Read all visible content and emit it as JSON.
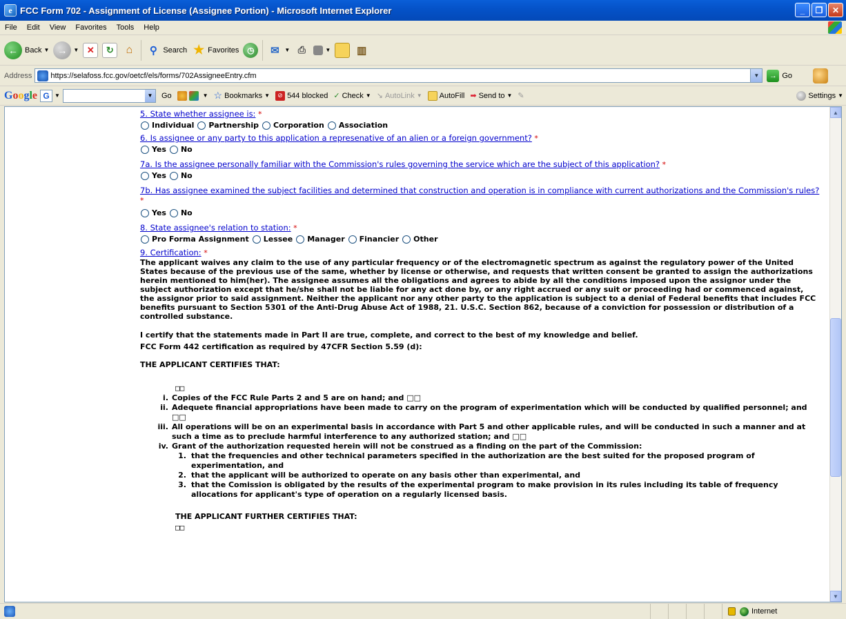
{
  "window": {
    "title": "FCC Form 702 - Assignment of License (Assignee Portion) - Microsoft Internet Explorer"
  },
  "menu": [
    "File",
    "Edit",
    "View",
    "Favorites",
    "Tools",
    "Help"
  ],
  "toolbar": {
    "back_label": "Back",
    "search_label": "Search",
    "favorites_label": "Favorites"
  },
  "address": {
    "label": "Address",
    "url": "https://selafoss.fcc.gov/oetcf/els/forms/702AssigneeEntry.cfm",
    "go_label": "Go"
  },
  "googlebar": {
    "go_label": "Go",
    "bookmarks_label": "Bookmarks",
    "blocked_label": "544 blocked",
    "check_label": "Check",
    "autolink_label": "AutoLink",
    "autofill_label": "AutoFill",
    "sendto_label": "Send to",
    "settings_label": "Settings"
  },
  "form": {
    "q5": {
      "label": "5. State whether assignee is:",
      "star": "*",
      "options": [
        "Individual",
        "Partnership",
        "Corporation",
        "Association"
      ]
    },
    "q6": {
      "label": "6. Is assignee or any party to this application a represenative of an alien or a foreign government?",
      "star": "*",
      "options": [
        "Yes",
        "No"
      ]
    },
    "q7a": {
      "label": "7a. Is the assignee personally familiar with the Commission's rules governing the service which are the subject of this application?",
      "star": "*",
      "options": [
        "Yes",
        "No"
      ]
    },
    "q7b": {
      "label": "7b. Has assignee examined the subject facilities and determined that construction and operation is in compliance with current authorizations and the Commission's rules?",
      "star": "*",
      "options": [
        "Yes",
        "No"
      ]
    },
    "q8": {
      "label": "8. State assignee's relation to station:",
      "star": "*",
      "options": [
        "Pro Forma Assignment",
        "Lessee",
        "Manager",
        "Financier",
        "Other"
      ]
    },
    "q9": {
      "label": "9. Certification:",
      "star": "*",
      "text": "The applicant waives any claim to the use of any particular frequency or of the electromagnetic spectrum as against the regulatory power of the United States because of the previous use of the same, whether by license or otherwise, and requests that written consent be granted to assign the authorizations herein mentioned to him(her). The assignee assumes all the obligations and agrees to abide by all the conditions imposed upon the assignor under the subject authorization except that he/she shall not be liable for any act done by, or any right accrued or any suit or proceeding had or commenced against, the assignor prior to said assignment. Neither the applicant nor any other party to the application is subject to a denial of Federal benefits that includes FCC benefits pursuant to Section 5301 of the Anti-Drug Abuse Act of 1988, 21. U.S.C. Section 862, because of a conviction for possession or distribution of a controlled substance.",
      "certify": "I certify that the statements made in Part II are true, complete, and correct to the best of my knowledge and belief.",
      "form442": "FCC Form 442 certification as required by 47CFR Section 5.59 (d):",
      "applicant_certifies": "THE APPLICANT CERTIFIES THAT:",
      "boxes": "□□",
      "items": [
        {
          "num": "i.",
          "text": "Copies of the FCC Rule Parts 2 and 5 are on hand; and □□"
        },
        {
          "num": "ii.",
          "text": "Adequete financial appropriations have been made to carry on the program of experimentation which will be conducted by qualified personnel; and □□"
        },
        {
          "num": "iii.",
          "text": "All operations will be on an experimental basis in accordance with Part 5 and other applicable rules, and will be conducted in such a manner and at such a time as to preclude harmful interference to any authorized station; and □□"
        },
        {
          "num": "iv.",
          "text": "Grant of the authorization requested herein will not be construed as a finding on the part of the Commission:"
        }
      ],
      "subitems": [
        {
          "num": "1.",
          "text": "that the frequencies and other technical parameters specified in the authorization are the best suited for the proposed program of experimentation, and"
        },
        {
          "num": "2.",
          "text": "that the applicant will be authorized to operate on any basis other than experimental, and"
        },
        {
          "num": "3.",
          "text": "that the Comission is obligated by the results of the experimental program to make provision in its rules including its table of frequency allocations for applicant's type of operation on a regularly licensed basis."
        }
      ],
      "further_certifies": "THE APPLICANT FURTHER CERTIFIES THAT:",
      "boxes2": "□□"
    }
  },
  "status": {
    "zone_label": "Internet"
  }
}
